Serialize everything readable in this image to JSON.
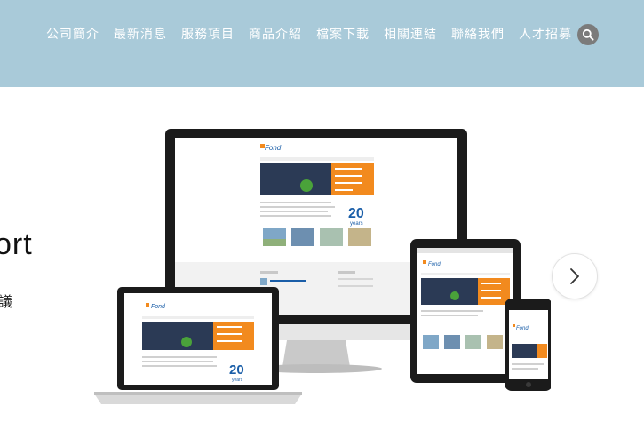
{
  "nav": {
    "items": [
      {
        "label": "公司簡介"
      },
      {
        "label": "最新消息"
      },
      {
        "label": "服務項目"
      },
      {
        "label": "商品介紹"
      },
      {
        "label": "檔案下載"
      },
      {
        "label": "相關連結"
      },
      {
        "label": "聯絡我們"
      },
      {
        "label": "人才招募"
      }
    ],
    "search_icon": "search-icon"
  },
  "hero": {
    "title": "ort",
    "subtitle": "議",
    "next_icon": "chevron-right-icon"
  },
  "mockup": {
    "logo_text": "Fond",
    "years_number": "20",
    "years_word": "years"
  },
  "colors": {
    "header_bg": "#a9cad9",
    "accent_orange": "#f28a1e",
    "accent_blue": "#1a5ea8"
  }
}
